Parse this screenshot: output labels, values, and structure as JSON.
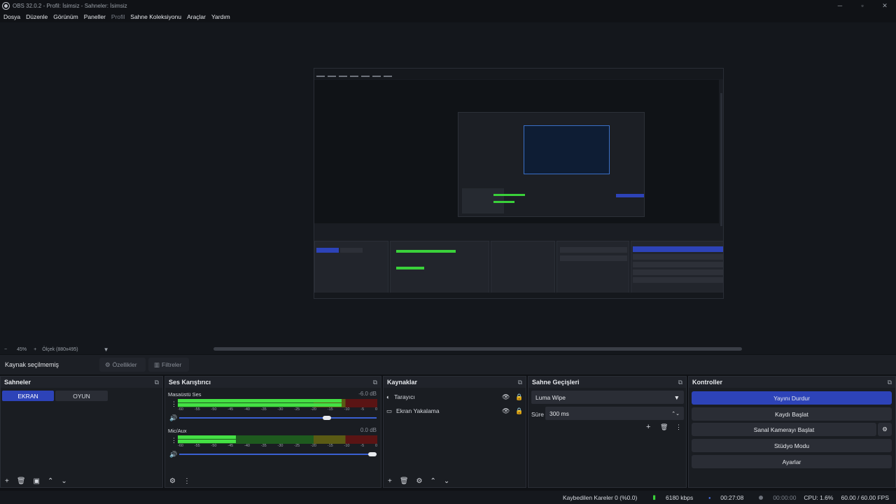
{
  "window": {
    "title": "OBS 32.0.2 - Profil: İsimsiz - Sahneler: İsimsiz"
  },
  "menu": [
    "Dosya",
    "Düzenle",
    "Görünüm",
    "Paneller",
    "Profil",
    "Sahne Koleksiyonu",
    "Araçlar",
    "Yardım"
  ],
  "zoom": {
    "percent": "45%",
    "scale_label": "Ölçek (880x495)"
  },
  "source_bar": {
    "label": "Kaynak seçilmemiş",
    "properties": "Özellikler",
    "filters": "Filtreler"
  },
  "scenes": {
    "title": "Sahneler",
    "items": [
      "EKRAN",
      "OYUN"
    ],
    "active": "EKRAN"
  },
  "mixer": {
    "title": "Ses Karıştırıcı",
    "channels": [
      {
        "name": "Masaüstü Ses",
        "db": "-6.0 dB",
        "level": 0.82,
        "volume": 0.77
      },
      {
        "name": "Mic/Aux",
        "db": "0.0 dB",
        "level": 0.29,
        "volume": 1.0
      }
    ],
    "ticks": [
      "-60",
      "-55",
      "-50",
      "-45",
      "-40",
      "-35",
      "-30",
      "-25",
      "-20",
      "-15",
      "-10",
      "-5",
      "0"
    ]
  },
  "sources": {
    "title": "Kaynaklar",
    "items": [
      "Tarayıcı",
      "Ekran Yakalama"
    ]
  },
  "transitions": {
    "title": "Sahne Geçişleri",
    "selected": "Luma Wipe",
    "duration_label": "Süre",
    "duration": "300 ms"
  },
  "controls": {
    "title": "Kontroller",
    "stream": "Yayını Durdur",
    "record": "Kaydı Başlat",
    "virtualcam": "Sanal Kamerayı Başlat",
    "studio": "Stüdyo Modu",
    "settings": "Ayarlar"
  },
  "status": {
    "dropped": "Kaybedilen Kareler 0 (%0.0)",
    "bitrate": "6180 kbps",
    "stream_time": "00:27:08",
    "rec_time": "00:00:00",
    "cpu": "CPU: 1.6%",
    "fps": "60.00 / 60.00 FPS"
  },
  "colors": {
    "accent": "#2d43b8",
    "meter_green": "#44e044"
  }
}
